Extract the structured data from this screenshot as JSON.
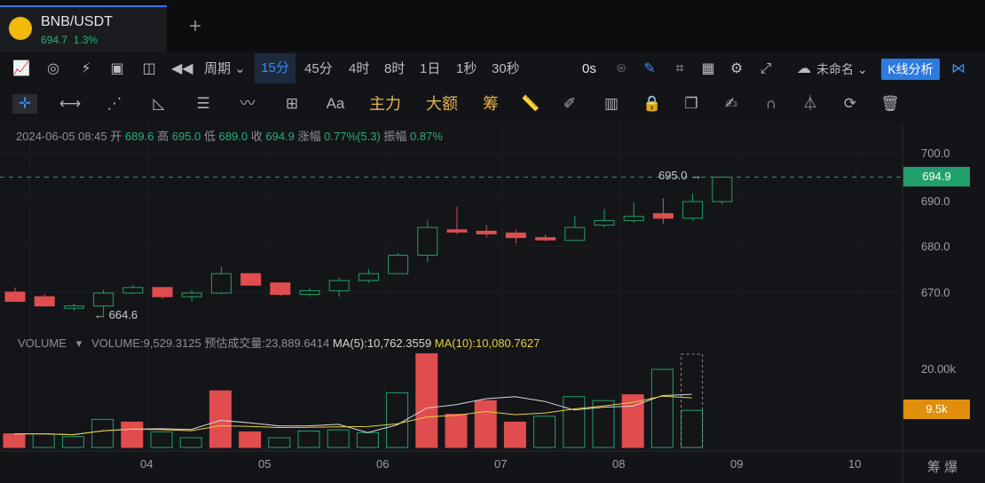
{
  "tab": {
    "symbol": "BNB/USDT",
    "price": "694.7",
    "change": "1.3%",
    "add": "+"
  },
  "toolbar": {
    "period": "周期",
    "tf_active": "15分",
    "timeframes": [
      "45分",
      "4时",
      "8时",
      "1日",
      "1秒",
      "30秒"
    ],
    "countdown": "0s",
    "layout_name": "未命名",
    "kline": "K线分析"
  },
  "drawing": {
    "text_tool": "Aa",
    "zhuli": "主力",
    "dae": "大额",
    "chou": "筹"
  },
  "ohlc": {
    "date": "2024-06-05 08:45",
    "open_label": "开",
    "open": "689.6",
    "high_label": "高",
    "high": "695.0",
    "low_label": "低",
    "low": "689.0",
    "close_label": "收",
    "close": "694.9",
    "chg_label": "涨幅",
    "chg": "0.77%(5.3)",
    "amp_label": "振幅",
    "amp": "0.87%"
  },
  "volume": {
    "name": "VOLUME",
    "value": "VOLUME:9,529.3125",
    "est": "预估成交量:23,889.6414",
    "ma5": "MA(5):10,762.3559",
    "ma10": "MA(10):10,080.7627"
  },
  "price_axis": {
    "ticks": [
      "700.0",
      "690.0",
      "680.0",
      "670.0"
    ],
    "current": "694.9"
  },
  "volume_axis": {
    "ticks": [
      "20.00k"
    ],
    "current": "9.5k"
  },
  "time_axis": [
    "04",
    "05",
    "06",
    "07",
    "08",
    "09",
    "10"
  ],
  "annotations": {
    "high": "695.0",
    "low": "664.6"
  },
  "bottom_right": "筹 爆",
  "colors": {
    "up": "#22a06b",
    "down": "#e04d4f",
    "accent": "#2e7be0",
    "ma5": "#d8d8d8",
    "ma10": "#e6cf3e"
  },
  "chart_data": {
    "type": "candlestick",
    "x": [
      "06-04 ~",
      "",
      "",
      "",
      "",
      "",
      "",
      "",
      "",
      "",
      "",
      "",
      "",
      "06-05 ~",
      "",
      "",
      "",
      "",
      "",
      "",
      "",
      "",
      "",
      "",
      "",
      "06-05 08:45"
    ],
    "candles": [
      {
        "o": 670.0,
        "h": 671.0,
        "l": 668.0,
        "c": 668.0
      },
      {
        "o": 669.0,
        "h": 669.5,
        "l": 667.0,
        "c": 667.0
      },
      {
        "o": 666.5,
        "h": 667.5,
        "l": 666.0,
        "c": 667.0
      },
      {
        "o": 667.0,
        "h": 670.5,
        "l": 664.6,
        "c": 669.8
      },
      {
        "o": 669.8,
        "h": 671.5,
        "l": 669.5,
        "c": 671.0
      },
      {
        "o": 671.0,
        "h": 671.0,
        "l": 668.5,
        "c": 669.0
      },
      {
        "o": 669.0,
        "h": 670.5,
        "l": 668.0,
        "c": 669.8
      },
      {
        "o": 669.8,
        "h": 675.5,
        "l": 669.5,
        "c": 674.0
      },
      {
        "o": 674.0,
        "h": 674.0,
        "l": 671.5,
        "c": 671.5
      },
      {
        "o": 672.0,
        "h": 672.0,
        "l": 669.0,
        "c": 669.5
      },
      {
        "o": 669.5,
        "h": 670.8,
        "l": 669.0,
        "c": 670.3
      },
      {
        "o": 670.3,
        "h": 673.2,
        "l": 669.0,
        "c": 672.5
      },
      {
        "o": 672.5,
        "h": 675.0,
        "l": 672.0,
        "c": 674.0
      },
      {
        "o": 674.0,
        "h": 678.5,
        "l": 674.0,
        "c": 678.0
      },
      {
        "o": 678.0,
        "h": 685.5,
        "l": 676.5,
        "c": 684.0
      },
      {
        "o": 683.5,
        "h": 688.5,
        "l": 682.5,
        "c": 683.0
      },
      {
        "o": 683.2,
        "h": 684.5,
        "l": 681.8,
        "c": 682.6
      },
      {
        "o": 682.8,
        "h": 683.5,
        "l": 680.5,
        "c": 681.8
      },
      {
        "o": 681.8,
        "h": 682.5,
        "l": 681.0,
        "c": 681.3
      },
      {
        "o": 681.2,
        "h": 686.5,
        "l": 681.0,
        "c": 684.0
      },
      {
        "o": 684.5,
        "h": 688.0,
        "l": 684.0,
        "c": 685.5
      },
      {
        "o": 685.5,
        "h": 689.5,
        "l": 685.0,
        "c": 686.4
      },
      {
        "o": 687.0,
        "h": 690.3,
        "l": 684.8,
        "c": 686.0
      },
      {
        "o": 686.0,
        "h": 691.3,
        "l": 685.5,
        "c": 689.6
      },
      {
        "o": 689.6,
        "h": 695.0,
        "l": 689.0,
        "c": 694.9
      }
    ],
    "volume": [
      3.5,
      3.5,
      2.8,
      7.2,
      6.5,
      4.0,
      2.5,
      14.5,
      4.0,
      2.5,
      4.2,
      4.5,
      3.8,
      14.0,
      24.0,
      8.5,
      12.0,
      6.5,
      8.0,
      13.0,
      12.0,
      13.5,
      20.0,
      9.5
    ],
    "volume_est_last": 23.9,
    "volume_unit": "k",
    "price_range": [
      660.0,
      702.0
    ],
    "volume_range": [
      0,
      25
    ],
    "legend": "top-left"
  }
}
